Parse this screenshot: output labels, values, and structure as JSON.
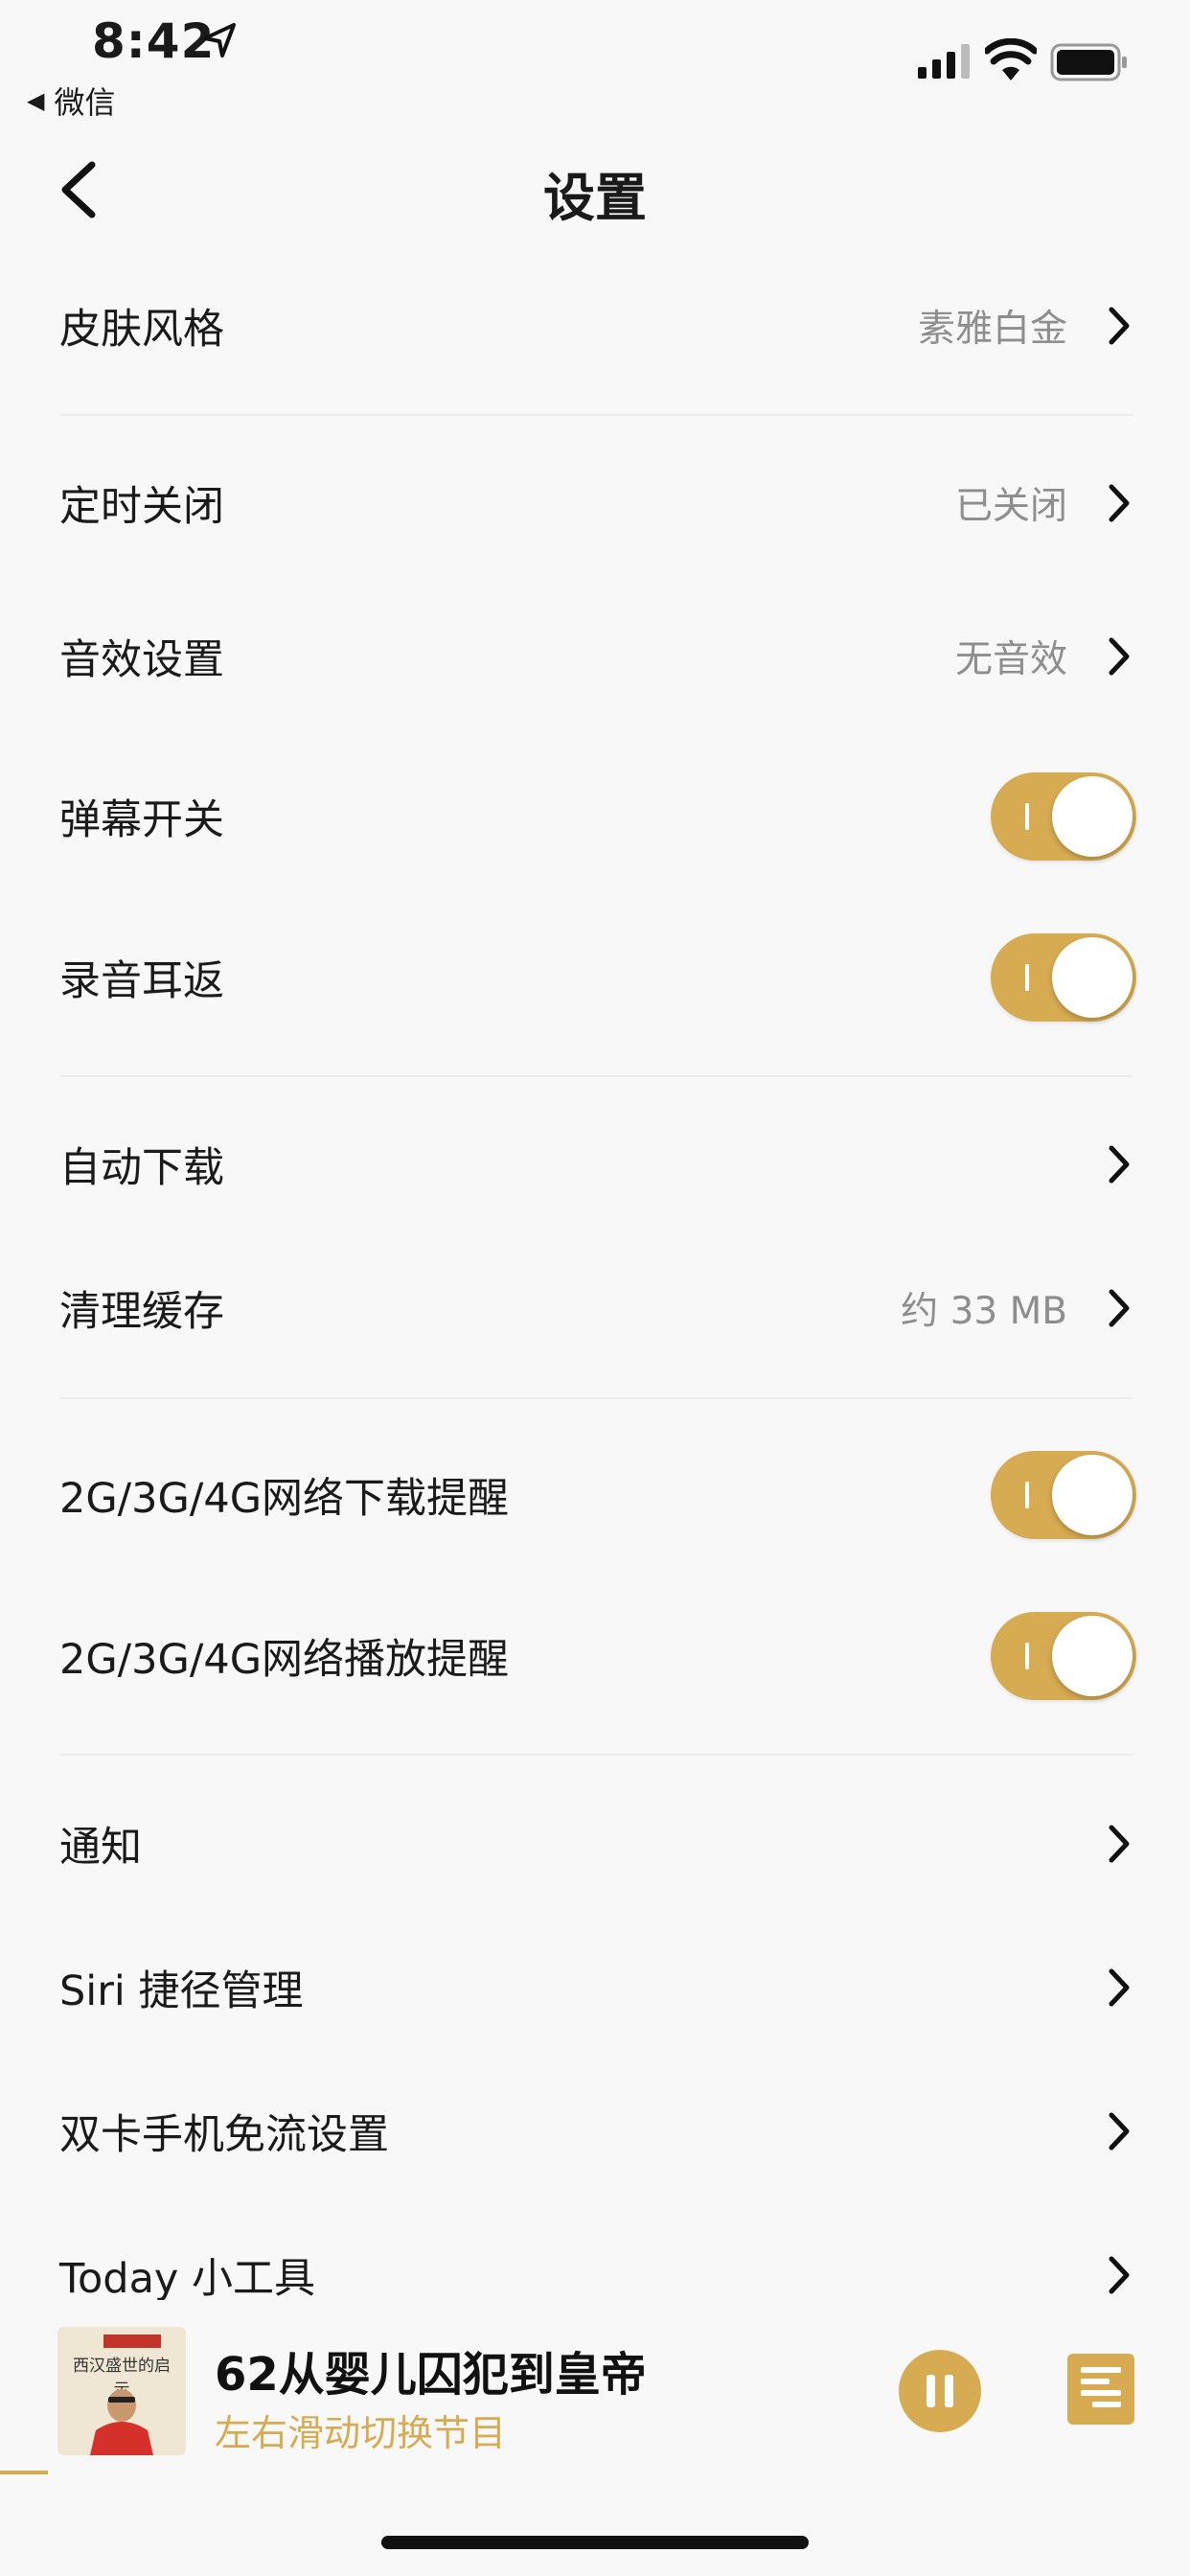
{
  "status_bar": {
    "time": "8:42",
    "back_app": "微信"
  },
  "nav": {
    "title": "设置"
  },
  "settings": {
    "skin": {
      "label": "皮肤风格",
      "value": "素雅白金"
    },
    "timer": {
      "label": "定时关闭",
      "value": "已关闭"
    },
    "sound_effect": {
      "label": "音效设置",
      "value": "无音效"
    },
    "danmaku": {
      "label": "弹幕开关",
      "on": true
    },
    "ear_return": {
      "label": "录音耳返",
      "on": true
    },
    "auto_download": {
      "label": "自动下载"
    },
    "clear_cache": {
      "label": "清理缓存",
      "value": "约 33 MB"
    },
    "cellular_download": {
      "label": "2G/3G/4G网络下载提醒",
      "on": true
    },
    "cellular_play": {
      "label": "2G/3G/4G网络播放提醒",
      "on": true
    },
    "notification": {
      "label": "通知"
    },
    "siri": {
      "label": "Siri 捷径管理"
    },
    "dual_sim": {
      "label": "双卡手机免流设置"
    },
    "today_widget": {
      "label": "Today 小工具"
    }
  },
  "player": {
    "title": "62从婴儿囚犯到皇帝",
    "subtitle": "左右滑动切换节目",
    "cover_title": "西汉盛世的启示",
    "progress": 0.04
  },
  "colors": {
    "accent": "#d6ab52",
    "background": "#f8f8f8",
    "value_gray": "#8e8e8e",
    "divider": "#ececec"
  }
}
